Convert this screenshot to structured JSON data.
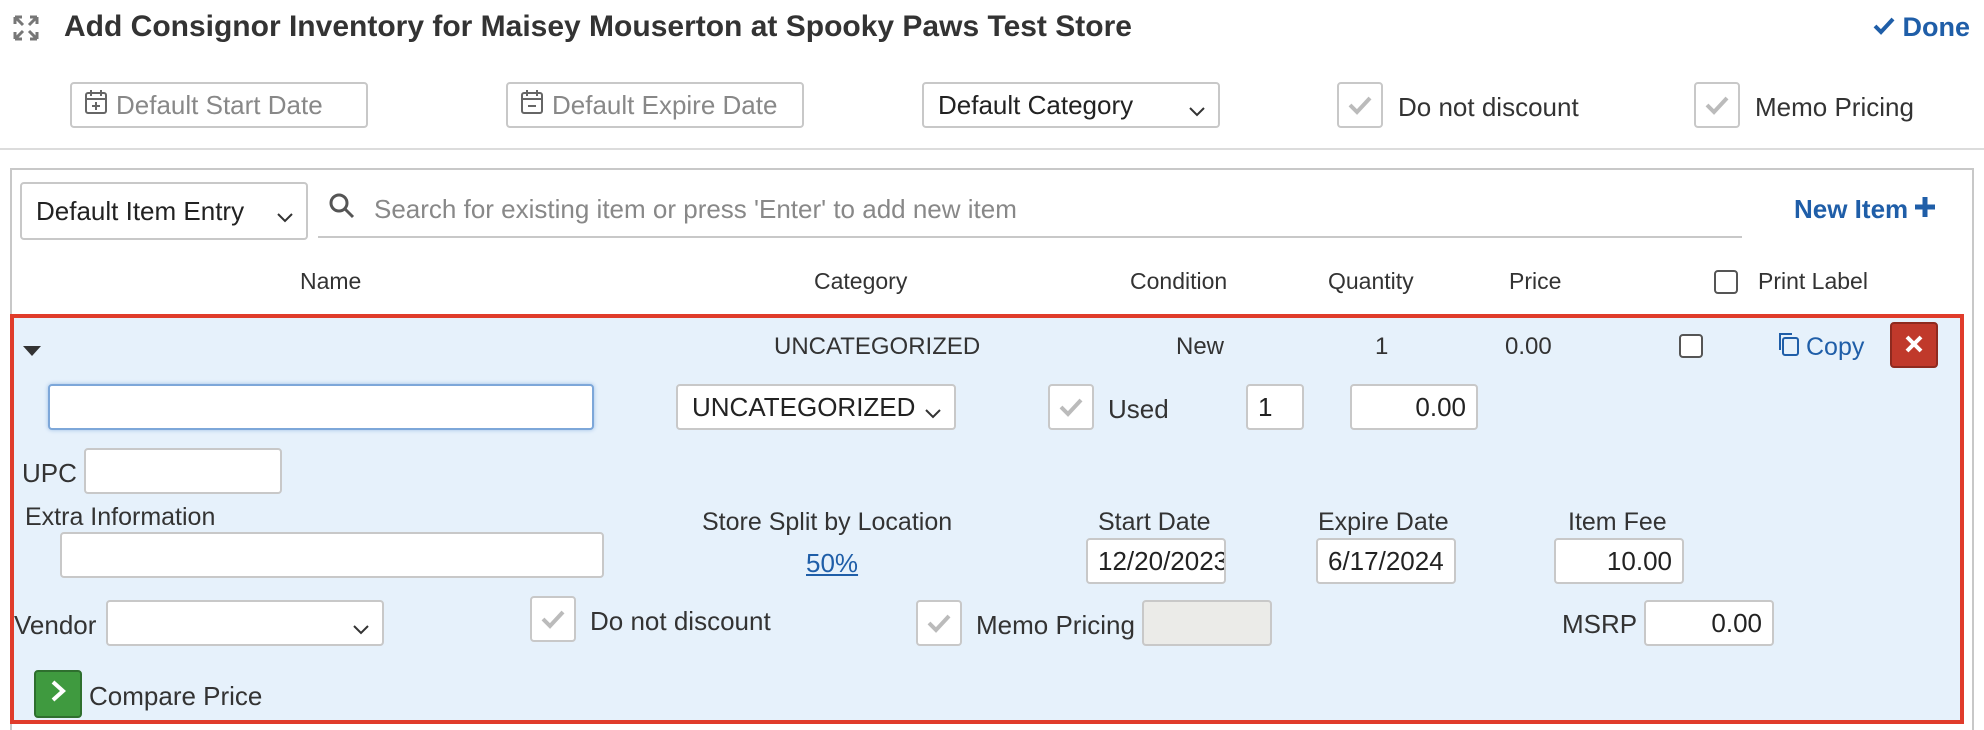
{
  "header": {
    "title": "Add Consignor Inventory for Maisey Mouserton at Spooky Paws Test Store",
    "done_label": "Done",
    "default_start_date_placeholder": "Default Start Date",
    "default_expire_date_placeholder": "Default Expire Date",
    "default_category": "Default Category",
    "do_not_discount_label": "Do not discount",
    "memo_pricing_label": "Memo Pricing"
  },
  "entry": {
    "mode": "Default Item Entry",
    "search_placeholder": "Search for existing item or press 'Enter' to add new item",
    "new_item_label": "New Item"
  },
  "columns": {
    "name": "Name",
    "category": "Category",
    "condition": "Condition",
    "quantity": "Quantity",
    "price": "Price",
    "print_label": "Print Label"
  },
  "item": {
    "summary": {
      "category": "UNCATEGORIZED",
      "condition": "New",
      "quantity": "1",
      "price": "0.00",
      "copy_label": "Copy"
    },
    "name_value": "",
    "category_select": "UNCATEGORIZED",
    "used_label": "Used",
    "quantity_value": "1",
    "price_value": "0.00",
    "upc_label": "UPC",
    "upc_value": "",
    "extra_info_label": "Extra Information",
    "extra_info_value": "",
    "store_split_label": "Store Split by Location",
    "store_split_value": "50%",
    "start_date_label": "Start Date",
    "start_date_value": "12/20/2023",
    "expire_date_label": "Expire Date",
    "expire_date_value": "6/17/2024",
    "item_fee_label": "Item Fee",
    "item_fee_value": "10.00",
    "vendor_label": "Vendor",
    "vendor_value": "",
    "do_not_discount_label": "Do not discount",
    "memo_pricing_label": "Memo Pricing",
    "msrp_label": "MSRP",
    "msrp_value": "0.00",
    "compare_price_label": "Compare Price"
  },
  "colors": {
    "accent": "#1f5ea8",
    "row_bg": "#e6f1fb",
    "highlight_border": "#e03c2b",
    "delete_bg": "#c0392b",
    "compare_bg": "#3f9a3f"
  }
}
